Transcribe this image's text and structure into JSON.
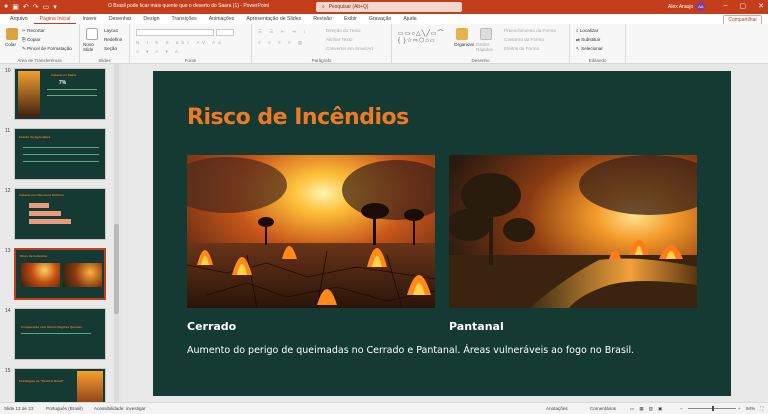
{
  "titlebar": {
    "title": "O Brasil pode ficar mais quente que o deserto do Saara (1) - PowerPoint",
    "search_placeholder": "Pesquisar (Alt+Q)",
    "user_name": "Alex Araujo",
    "user_initials": "AA"
  },
  "tabs": [
    "Arquivo",
    "Página Inicial",
    "Inserir",
    "Desenhar",
    "Design",
    "Transições",
    "Animações",
    "Apresentação de Slides",
    "Revisão",
    "Exibir",
    "Gravação",
    "Ajuda"
  ],
  "active_tab": "Página Inicial",
  "share_label": "Compartilhar",
  "ribbon": {
    "clipboard": {
      "paste": "Colar",
      "cut": "Recortar",
      "copy": "Copiar",
      "painter": "Pincel de Formatação",
      "label": "Área de Transferência"
    },
    "slides": {
      "new_slide": "Novo Slide",
      "layout": "Layout",
      "reset": "Redefinir",
      "section": "Seção",
      "label": "Slides"
    },
    "font": {
      "label": "Fonte"
    },
    "paragraph": {
      "text_direction": "Direção do Texto",
      "align_text": "Alinhar Texto",
      "smartart": "Converter em SmartArt",
      "label": "Parágrafo"
    },
    "drawing": {
      "arrange": "Organizar",
      "quick_styles": "Estilos Rápidos",
      "fill": "Preenchimento da Forma",
      "outline": "Contorno da Forma",
      "effects": "Efeitos de Forma",
      "label": "Desenho"
    },
    "editing": {
      "find": "Localizar",
      "replace": "Substituir",
      "select": "Selecionar",
      "label": "Editando"
    }
  },
  "thumbnails": [
    {
      "num": "10",
      "title": "Impacto no Saara",
      "stat": "7%"
    },
    {
      "num": "11",
      "title": "Estudo da Agricultura"
    },
    {
      "num": "12",
      "title": "Impacto nos Recursos Hídricos"
    },
    {
      "num": "13",
      "title": "Risco de Incêndios"
    },
    {
      "num": "14",
      "title": "Comparação com Outras Regiões Quentes"
    },
    {
      "num": "15",
      "title": "Estratégias de \"Resfriar Brasil\""
    }
  ],
  "slide": {
    "title": "Risco de Incêndios",
    "caption_left": "Cerrado",
    "caption_right": "Pantanal",
    "body": "Aumento do perigo de queimadas no Cerrado e Pantanal. Áreas vulneráveis ao fogo no Brasil."
  },
  "status": {
    "slide_count": "Slide 13 de 23",
    "language": "Português (Brasil)",
    "accessibility": "Acessibilidade: investigar",
    "notes": "Anotações",
    "comments": "Comentários",
    "zoom": "94%"
  },
  "colors": {
    "accent": "#c43e1c",
    "slide_bg": "#143a33",
    "title_orange": "#f07a22"
  }
}
